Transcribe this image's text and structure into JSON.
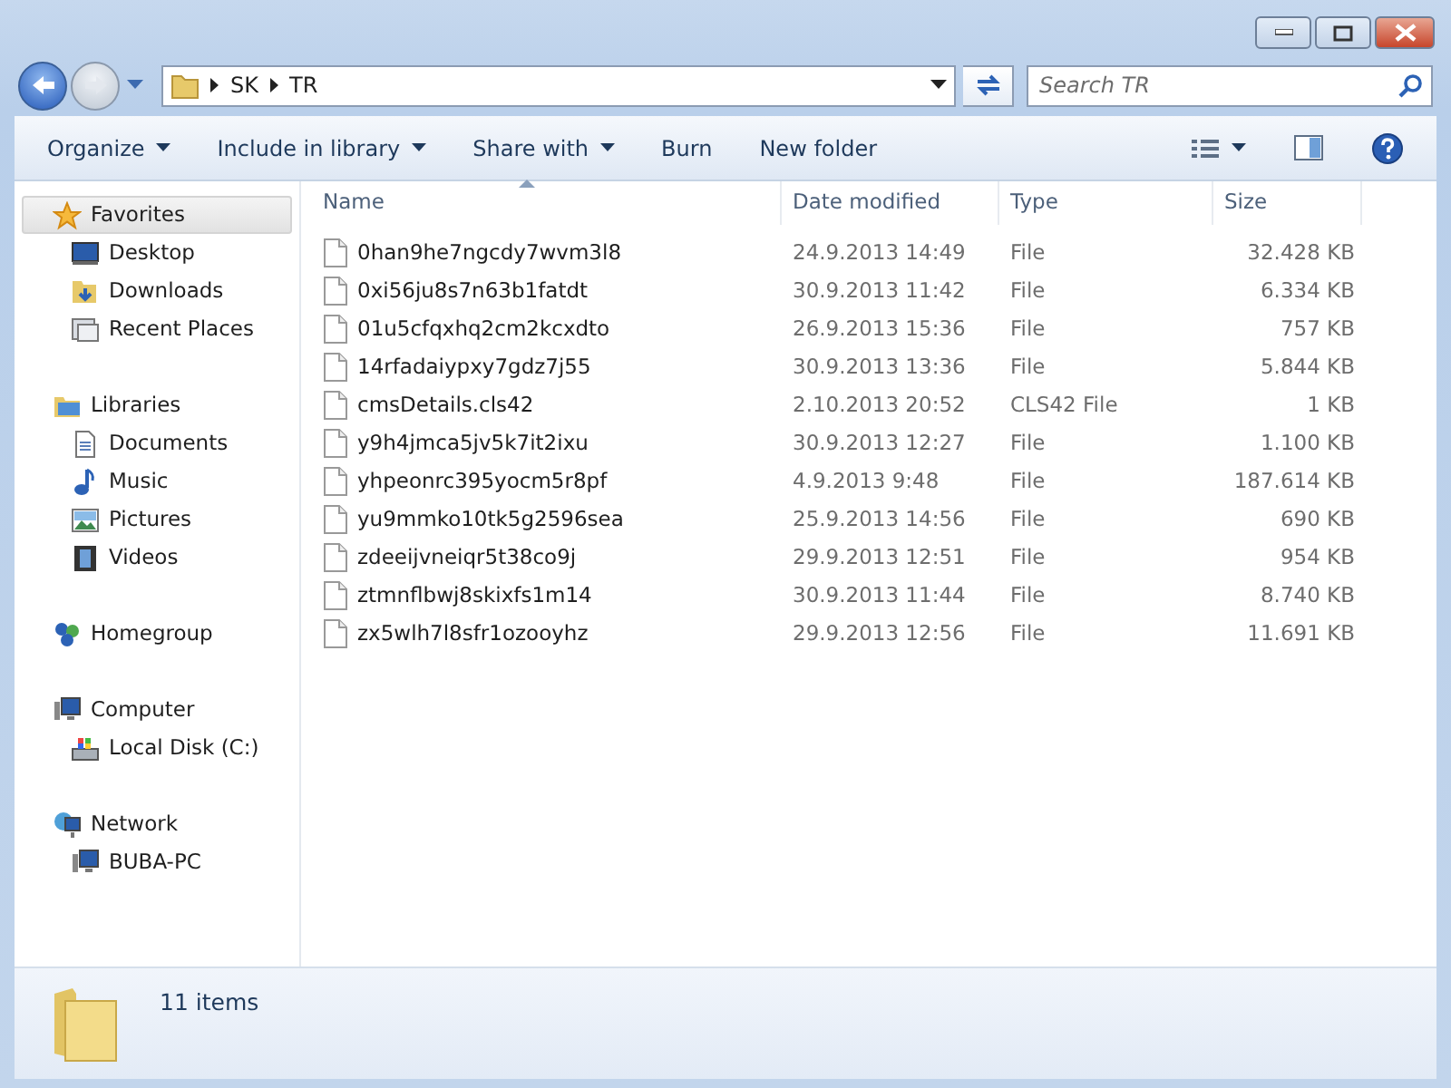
{
  "address": {
    "crumbs": [
      "SK",
      "TR"
    ]
  },
  "search": {
    "placeholder": "Search TR"
  },
  "toolbar": [
    {
      "label": "Organize",
      "has_menu": true
    },
    {
      "label": "Include in library",
      "has_menu": true
    },
    {
      "label": "Share with",
      "has_menu": true
    },
    {
      "label": "Burn",
      "has_menu": false
    },
    {
      "label": "New folder",
      "has_menu": false
    }
  ],
  "sidebar": {
    "groups": [
      {
        "label": "Favorites",
        "kind": "star",
        "selected": true,
        "children": [
          {
            "label": "Desktop",
            "kind": "desktop",
            "selected": false
          },
          {
            "label": "Downloads",
            "kind": "downloads",
            "selected": false
          },
          {
            "label": "Recent Places",
            "kind": "recent",
            "selected": false
          }
        ]
      },
      {
        "label": "Libraries",
        "kind": "library",
        "selected": false,
        "children": [
          {
            "label": "Documents",
            "kind": "document",
            "selected": false
          },
          {
            "label": "Music",
            "kind": "music",
            "selected": false
          },
          {
            "label": "Pictures",
            "kind": "pictures",
            "selected": false
          },
          {
            "label": "Videos",
            "kind": "videos",
            "selected": false
          }
        ]
      },
      {
        "label": "Homegroup",
        "kind": "homegroup",
        "selected": false
      },
      {
        "label": "Computer",
        "kind": "computer",
        "selected": false,
        "children": [
          {
            "label": "Local Disk (C:)",
            "kind": "disk",
            "selected": false
          }
        ]
      },
      {
        "label": "Network",
        "kind": "network",
        "selected": false,
        "children": [
          {
            "label": "BUBA-PC",
            "kind": "computer",
            "selected": false
          }
        ]
      }
    ]
  },
  "table": {
    "columns": [
      {
        "label": "Name",
        "sorted": true
      },
      {
        "label": "Date modified",
        "sorted": false
      },
      {
        "label": "Type",
        "sorted": false
      },
      {
        "label": "Size",
        "sorted": false
      }
    ],
    "rows": [
      [
        "0han9he7ngcdy7wvm3l8",
        "24.9.2013 14:49",
        "File",
        "32.428 KB"
      ],
      [
        "0xi56ju8s7n63b1fatdt",
        "30.9.2013 11:42",
        "File",
        "6.334 KB"
      ],
      [
        "01u5cfqxhq2cm2kcxdto",
        "26.9.2013 15:36",
        "File",
        "757 KB"
      ],
      [
        "14rfadaiypxy7gdz7j55",
        "30.9.2013 13:36",
        "File",
        "5.844 KB"
      ],
      [
        "cmsDetails.cls42",
        "2.10.2013 20:52",
        "CLS42 File",
        "1 KB"
      ],
      [
        "y9h4jmca5jv5k7it2ixu",
        "30.9.2013 12:27",
        "File",
        "1.100 KB"
      ],
      [
        "yhpeonrc395yocm5r8pf",
        "4.9.2013 9:48",
        "File",
        "187.614 KB"
      ],
      [
        "yu9mmko10tk5g2596sea",
        "25.9.2013 14:56",
        "File",
        "690 KB"
      ],
      [
        "zdeeijvneiqr5t38co9j",
        "29.9.2013 12:51",
        "File",
        "954 KB"
      ],
      [
        "ztmnflbwj8skixfs1m14",
        "30.9.2013 11:44",
        "File",
        "8.740 KB"
      ],
      [
        "zx5wlh7l8sfr1ozooyhz",
        "29.9.2013 12:56",
        "File",
        "11.691 KB"
      ]
    ]
  },
  "status_bar": {
    "text": "11 items"
  }
}
